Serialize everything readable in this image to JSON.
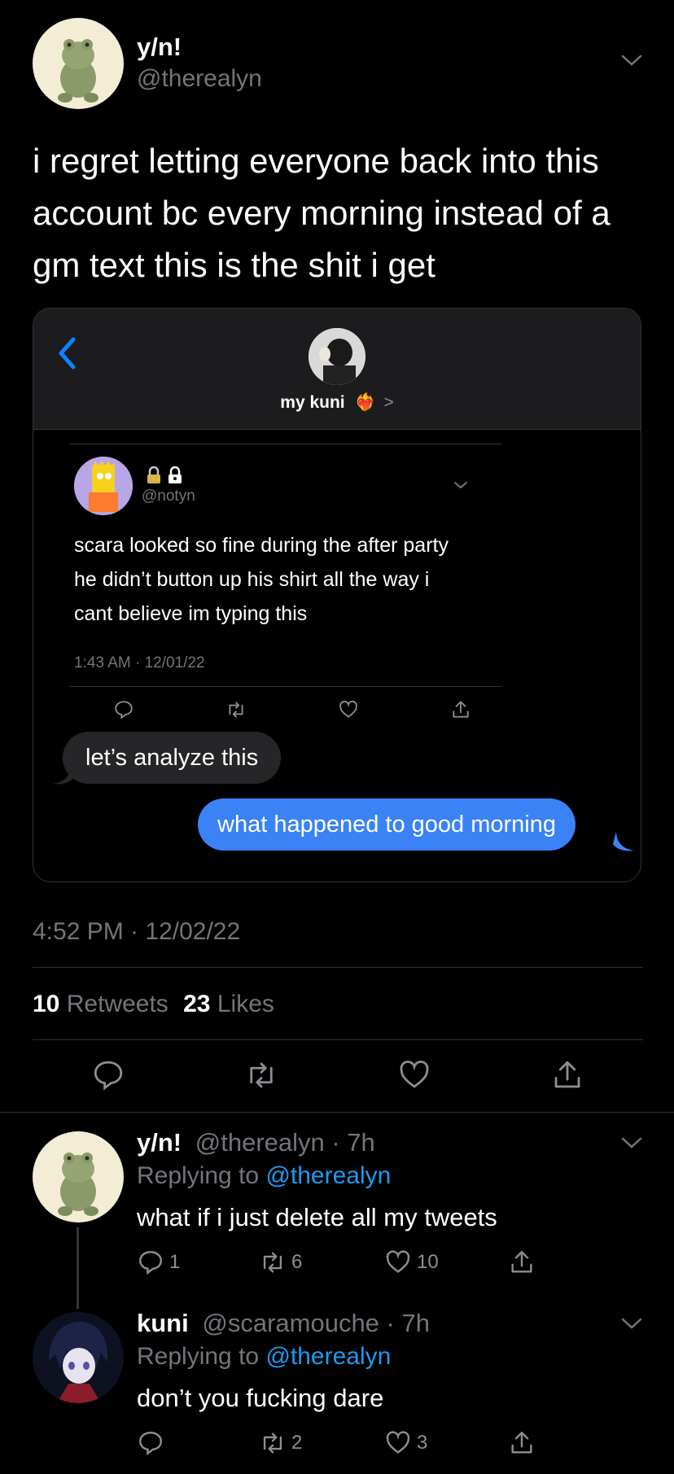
{
  "main_tweet": {
    "display_name": "y/n!",
    "handle": "@therealyn",
    "text": "i regret letting everyone back into this account bc every morning instead of a gm text this is the shit i get",
    "timestamp": "4:52 PM · 12/02/22",
    "retweets_count": "10",
    "retweets_label": "Retweets",
    "likes_count": "23",
    "likes_label": "Likes"
  },
  "screenshot": {
    "contact_name": "my kuni",
    "contact_heart": "❤️‍🔥",
    "contact_chevron": ">",
    "quoted_tweet": {
      "handle": "@notyn",
      "text": "scara looked so fine during the after party he didn’t button up his shirt all the way i cant believe im typing this",
      "timestamp": "1:43 AM · 12/01/22"
    },
    "received_message": "let’s analyze this",
    "sent_message": "what happened to good morning"
  },
  "replies": [
    {
      "display_name": "y/n!",
      "handle_time": "@therealyn · 7h",
      "replying_label": "Replying to",
      "replying_to": "@therealyn",
      "text": "what if i just delete all my tweets",
      "replies": "1",
      "retweets": "6",
      "likes": "10"
    },
    {
      "display_name": "kuni",
      "handle_time": "@scaramouche · 7h",
      "replying_label": "Replying to",
      "replying_to": "@therealyn",
      "text": "don’t you fucking dare",
      "replies": "",
      "retweets": "2",
      "likes": "3"
    }
  ],
  "colors": {
    "background": "#000000",
    "accent": "#1d9bf0",
    "imessage_blue": "#3b82f6",
    "bubble_gray": "#262628"
  }
}
